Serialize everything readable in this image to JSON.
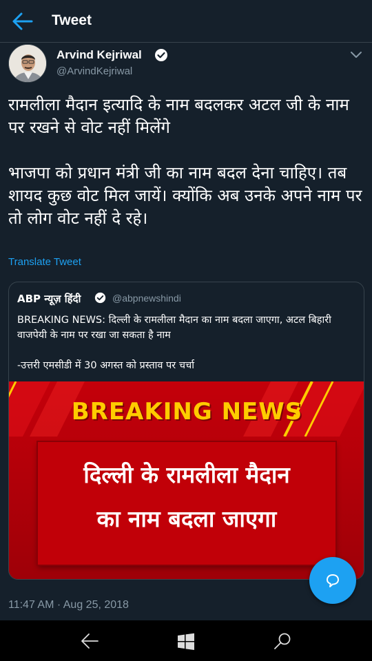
{
  "header": {
    "title": "Tweet"
  },
  "author": {
    "name": "Arvind Kejriwal",
    "handle": "@ArvindKejriwal"
  },
  "tweet": {
    "text": "रामलीला मैदान इत्यादि के नाम बदलकर अटल जी के नाम पर रखने से वोट नहीं मिलेंगे\n\nभाजपा को प्रधान मंत्री जी का नाम बदल देना चाहिए। तब शायद कुछ वोट मिल जायें। क्योंकि अब उनके अपने नाम पर तो लोग वोट नहीं दे रहे।",
    "translate_label": "Translate Tweet",
    "timestamp": "11:47 AM · Aug 25, 2018"
  },
  "quote": {
    "name": "ABP न्यूज़ हिंदी",
    "handle": "@abpnewshindi",
    "text": "BREAKING NEWS: दिल्ली के रामलीला मैदान का नाम बदला जाएगा, अटल बिहारी वाजपेयी के नाम पर रखा जा सकता है नाम\n\n-उत्तरी एमसीडी में 30 अगस्त को प्रस्ताव पर चर्चा",
    "image": {
      "banner": "BREAKING NEWS",
      "line1": "दिल्ली के रामलीला मैदान",
      "line2": "का नाम बदला जाएगा"
    }
  },
  "colors": {
    "background": "#15202b",
    "accent": "#1da1f2",
    "muted": "#8899a6",
    "border": "#38444d"
  },
  "icons": {
    "back": "arrow-left-icon",
    "verified": "verified-badge-icon",
    "more": "chevron-down-icon",
    "reply": "speech-bubble-icon",
    "nav_back": "nav-back-icon",
    "nav_start": "windows-logo-icon",
    "nav_search": "search-icon"
  }
}
